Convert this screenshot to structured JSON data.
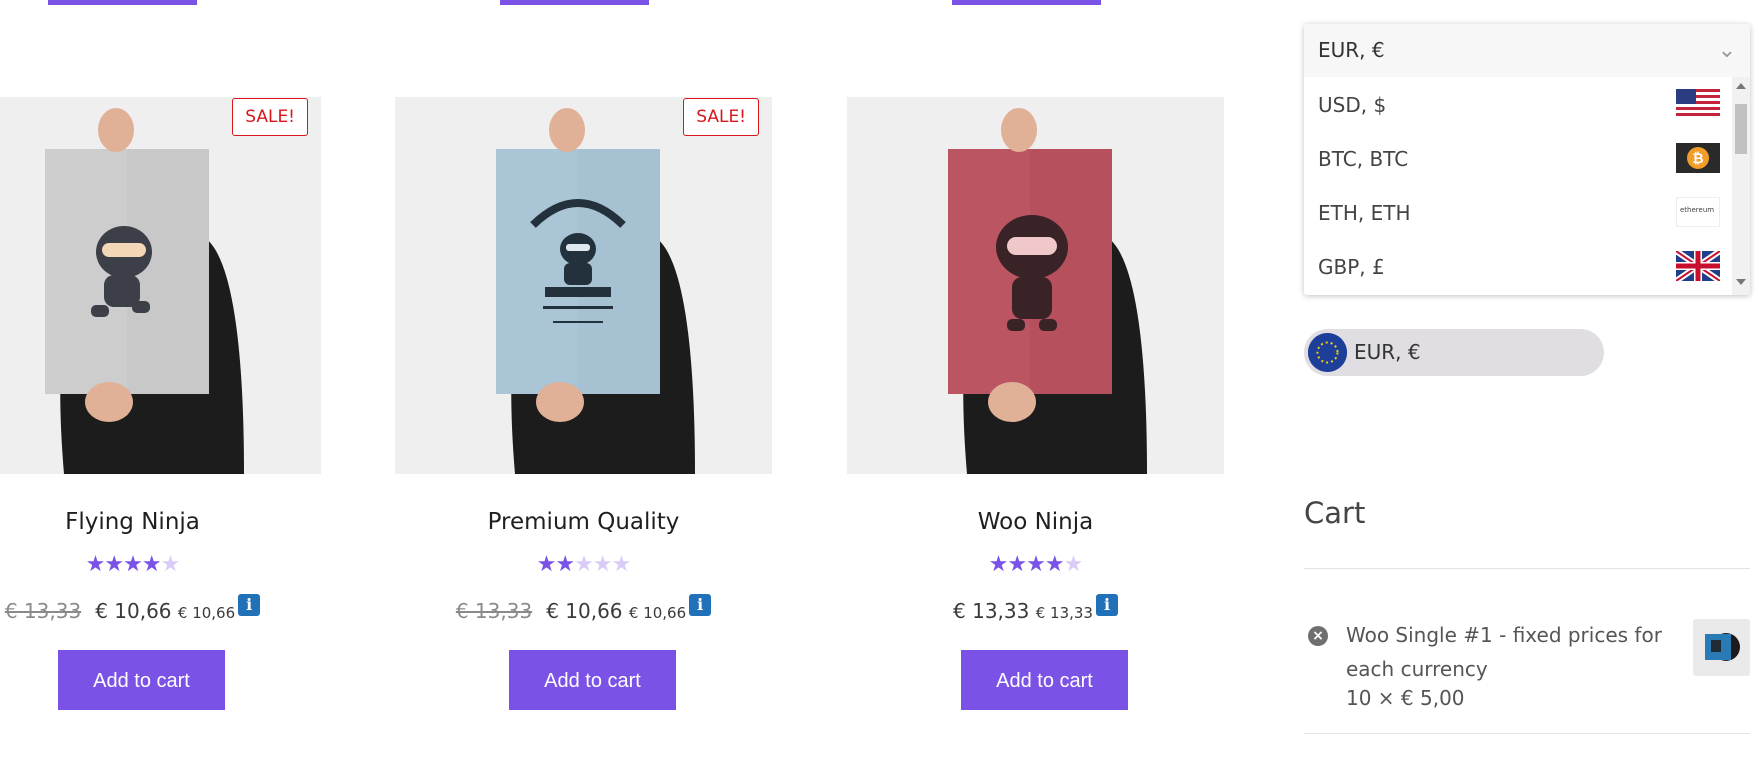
{
  "products": [
    {
      "title": "Flying Ninja",
      "sale_badge": "SALE!",
      "rating": 4,
      "rating_max": 5,
      "old_price": "€ 13,33",
      "price": "€ 10,66",
      "alt_price": "€ 10,66",
      "button": "Add to cart"
    },
    {
      "title": "Premium Quality",
      "sale_badge": "SALE!",
      "rating": 2,
      "rating_max": 5,
      "old_price": "€ 13,33",
      "price": "€ 10,66",
      "alt_price": "€ 10,66",
      "button": "Add to cart"
    },
    {
      "title": "Woo Ninja",
      "sale_badge": "",
      "rating": 4,
      "rating_max": 5,
      "old_price": "",
      "price": "€ 13,33",
      "alt_price": "€ 13,33",
      "button": "Add to cart"
    }
  ],
  "info_icon": "i",
  "currency_dropdown": {
    "selected": "EUR, €",
    "options": [
      {
        "label": "USD, $",
        "icon": "us-flag-icon"
      },
      {
        "label": "BTC, BTC",
        "icon": "bitcoin-icon"
      },
      {
        "label": "ETH, ETH",
        "icon": "ethereum-icon",
        "icon_text": "ethereum"
      },
      {
        "label": "GBP, £",
        "icon": "uk-flag-icon"
      }
    ]
  },
  "currency_pill": {
    "label": "EUR, €",
    "icon": "eu-flag-icon"
  },
  "cart": {
    "title": "Cart",
    "items": [
      {
        "title": "Woo Single #1 - fixed prices for each currency",
        "quantity_line": "10 × € 5,00",
        "remove_icon": "remove-icon"
      }
    ]
  },
  "colors": {
    "accent": "#7b52e6",
    "sale": "#d8161b",
    "info": "#2071b8"
  }
}
